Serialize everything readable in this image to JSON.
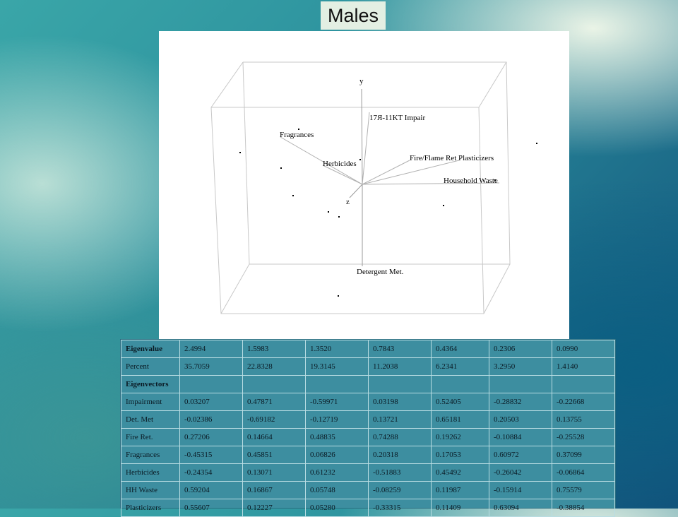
{
  "slide": {
    "title": "Males"
  },
  "plot": {
    "axis_labels": {
      "y": "y",
      "z": "z"
    },
    "loadings": [
      "17Я-11KT Impair",
      "Fragrances",
      "Herbicides",
      "Fire/Flame Ret",
      "Plasticizers",
      "Household Waste",
      "Detergent Met."
    ]
  },
  "table": {
    "header": {
      "label": "Eigenvalue",
      "values": [
        "2.4994",
        "1.5983",
        "1.3520",
        "0.7843",
        "0.4364",
        "0.2306",
        "0.0990"
      ]
    },
    "rows": [
      {
        "label": "Percent",
        "values": [
          "35.7059",
          "22.8328",
          "19.3145",
          "11.2038",
          "6.2341",
          "3.2950",
          "1.4140"
        ]
      },
      {
        "label": "Eigenvectors",
        "values": [
          "",
          "",
          "",
          "",
          "",
          "",
          ""
        ]
      },
      {
        "label": "Impairment",
        "values": [
          "0.03207",
          "0.47871",
          "-0.59971",
          "0.03198",
          "0.52405",
          "-0.28832",
          "-0.22668"
        ]
      },
      {
        "label": "Det. Met",
        "values": [
          "-0.02386",
          "-0.69182",
          "-0.12719",
          "0.13721",
          "0.65181",
          "0.20503",
          "0.13755"
        ]
      },
      {
        "label": "Fire Ret.",
        "values": [
          "0.27206",
          "0.14664",
          "0.48835",
          "0.74288",
          "0.19262",
          "-0.10884",
          "-0.25528"
        ]
      },
      {
        "label": "Fragrances",
        "values": [
          "-0.45315",
          "0.45851",
          "0.06826",
          "0.20318",
          "0.17053",
          "0.60972",
          "0.37099"
        ]
      },
      {
        "label": "Herbicides",
        "values": [
          "-0.24354",
          "0.13071",
          "0.61232",
          "-0.51883",
          "0.45492",
          "-0.26042",
          "-0.06864"
        ]
      },
      {
        "label": "HH Waste",
        "values": [
          "0.59204",
          "0.16867",
          "0.05748",
          "-0.08259",
          "0.11987",
          "-0.15914",
          "0.75579"
        ]
      },
      {
        "label": "Plasticizers",
        "values": [
          "0.55607",
          "0.12227",
          "0.05280",
          "-0.33315",
          "0.11409",
          "0.63094",
          "-0.38854"
        ]
      }
    ]
  }
}
